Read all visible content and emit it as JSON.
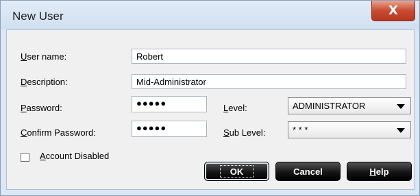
{
  "window": {
    "title": "New User",
    "close_symbol": "X"
  },
  "form": {
    "user_name_label_accel": "U",
    "user_name_label_rest": "ser name:",
    "user_name_value": "Robert",
    "description_label_accel": "D",
    "description_label_rest": "escription:",
    "description_value": "Mid-Administrator",
    "password_label_accel": "P",
    "password_label_rest": "assword:",
    "password_mask": "●●●●●",
    "confirm_label_accel": "C",
    "confirm_label_rest": "onfirm Password:",
    "confirm_mask": "●●●●●",
    "level_label_accel": "L",
    "level_label_rest": "evel:",
    "level_value": "ADMINISTRATOR",
    "sublevel_label_accel": "S",
    "sublevel_label_rest": "ub Level:",
    "sublevel_value": "* * *",
    "account_disabled_accel": "A",
    "account_disabled_rest": "ccount Disabled",
    "account_disabled_checked": false
  },
  "buttons": {
    "ok_label": "OK",
    "cancel_label": "Cancel",
    "help_accel": "H",
    "help_rest": "elp"
  },
  "icons": {
    "close": "close-icon",
    "dropdown": "chevron-down-icon"
  },
  "colors": {
    "close_button": "#c84b32",
    "button_bg": "#151515",
    "frame": "#dbe7f4"
  }
}
